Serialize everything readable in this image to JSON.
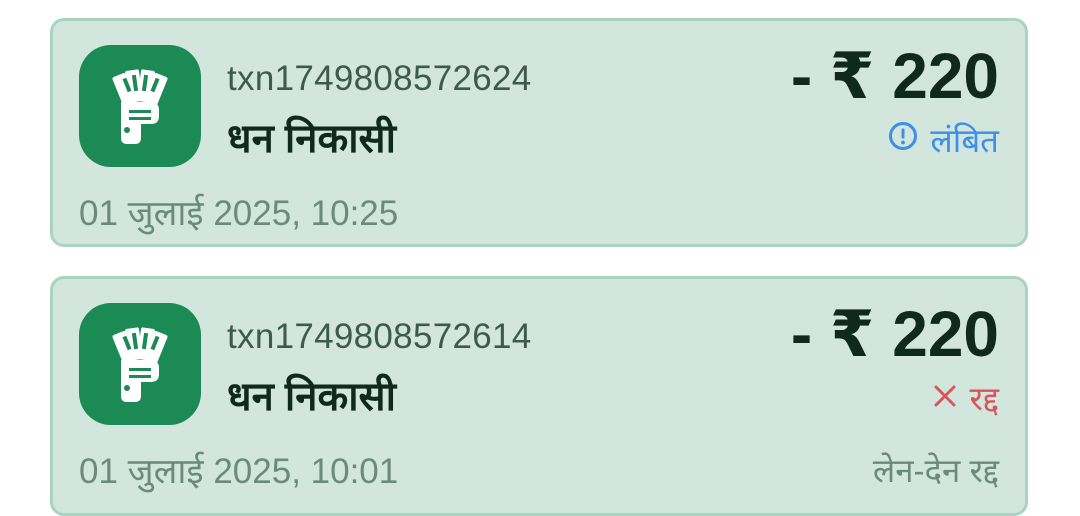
{
  "transactions": [
    {
      "icon": "cash-withdrawal-icon",
      "id": "txn1749808572624",
      "type": "धन निकासी",
      "amount": "- ₹ 220",
      "status_icon": "info-circle-icon",
      "status": "लंबित",
      "date": "01 जुलाई 2025, 10:25",
      "note": ""
    },
    {
      "icon": "cash-withdrawal-icon",
      "id": "txn1749808572614",
      "type": "धन निकासी",
      "amount": "- ₹ 220",
      "status_icon": "close-icon",
      "status": "रद्द",
      "date": "01 जुलाई 2025, 10:01",
      "note": "लेन-देन रद्द"
    }
  ],
  "colors": {
    "card_bg": "#d2e6de",
    "card_border": "#a9d3c2",
    "icon_bg": "#1b8a55",
    "pending": "#3d8fe8",
    "cancelled": "#d9545b"
  }
}
